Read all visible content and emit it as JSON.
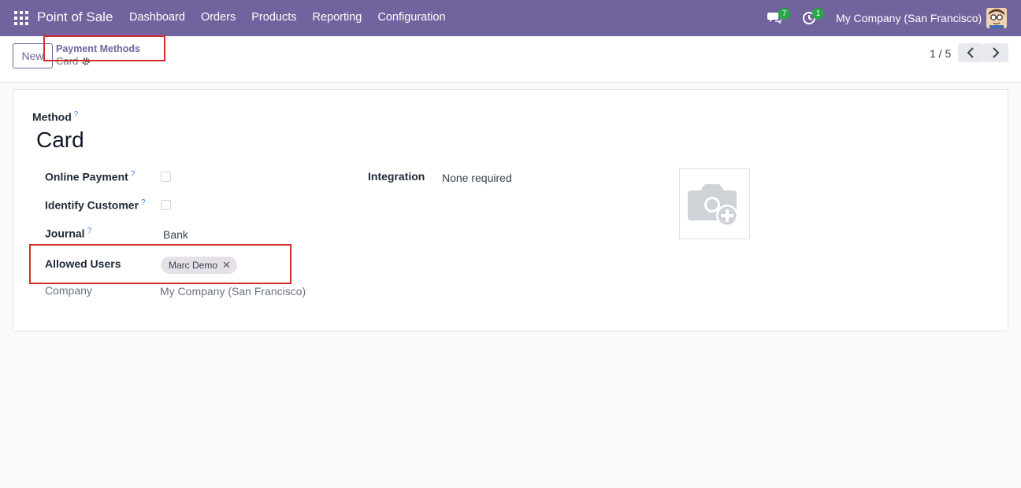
{
  "navbar": {
    "brand": "Point of Sale",
    "menu": [
      "Dashboard",
      "Orders",
      "Products",
      "Reporting",
      "Configuration"
    ],
    "chat_count": "7",
    "activity_count": "1",
    "company": "My Company (San Francisco)"
  },
  "control": {
    "new_label": "New",
    "breadcrumb_parent": "Payment Methods",
    "breadcrumb_current": "Card",
    "pager": "1 / 5"
  },
  "form": {
    "method_label": "Method",
    "method_value": "Card",
    "online_payment_label": "Online Payment",
    "online_payment_checked": false,
    "identify_customer_label": "Identify Customer",
    "identify_customer_checked": false,
    "journal_label": "Journal",
    "journal_value": "Bank",
    "allowed_users_label": "Allowed Users",
    "allowed_users": [
      "Marc Demo"
    ],
    "company_label": "Company",
    "company_value": "My Company (San Francisco)",
    "integration_label": "Integration",
    "integration_value": "None required",
    "help_mark": "?"
  },
  "colors": {
    "navbar": "#71639e",
    "highlight": "#d32b2b",
    "help": "#3b82f6"
  }
}
